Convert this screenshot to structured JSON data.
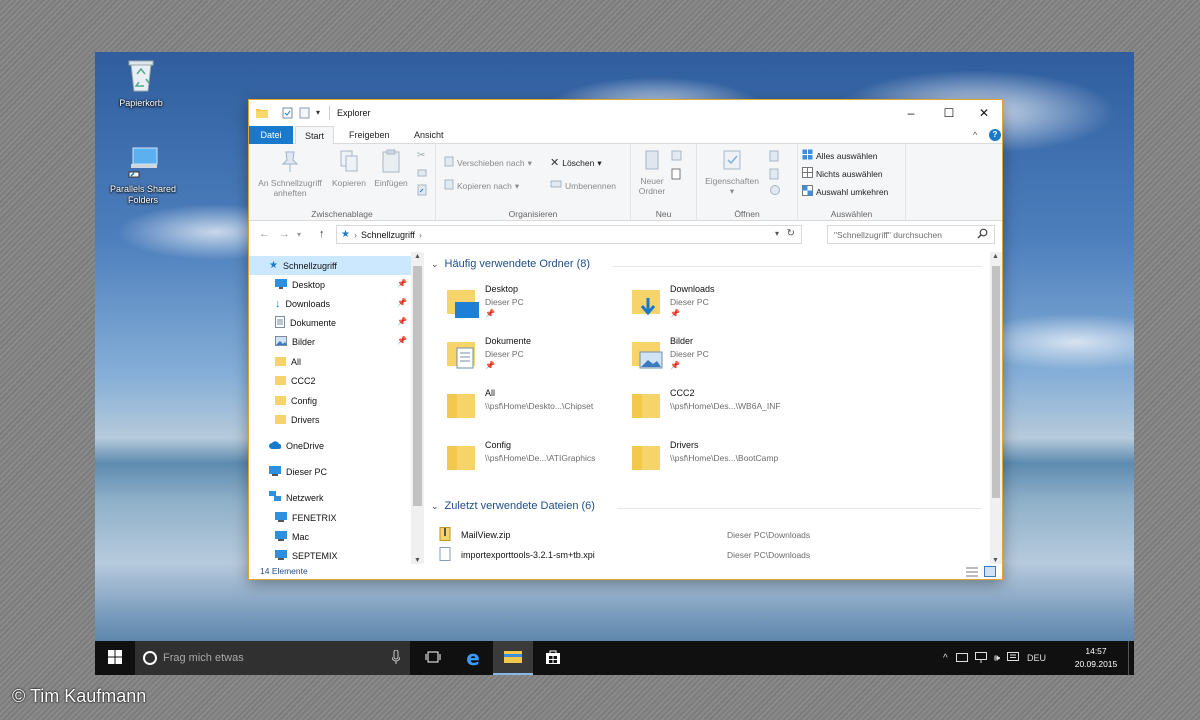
{
  "desktop": {
    "icons": [
      {
        "label": "Papierkorb",
        "icon": "recycle-bin-icon"
      },
      {
        "label": "Parallels Shared Folders",
        "icon": "shared-folder-icon"
      }
    ]
  },
  "window": {
    "title": "Explorer",
    "controls": {
      "minimize": "–",
      "maximize": "☐",
      "close": "✕"
    },
    "accent_color": "#1979ca",
    "tabs": [
      "Datei",
      "Start",
      "Freigeben",
      "Ansicht"
    ],
    "ribbon": {
      "help": "?",
      "collapse": "^",
      "groups": {
        "zwischenablage": {
          "label": "Zwischenablage",
          "pin_label": "An Schnellzugriff anheften",
          "copy_label": "Kopieren",
          "paste_label": "Einfügen"
        },
        "organisieren": {
          "label": "Organisieren",
          "move_label": "Verschieben nach",
          "copy_to_label": "Kopieren nach",
          "delete_label": "Löschen",
          "rename_label": "Umbenennen"
        },
        "neu": {
          "label": "Neu",
          "new_folder_label": "Neuer Ordner"
        },
        "oeffnen": {
          "label": "Öffnen",
          "properties_label": "Eigenschaften"
        },
        "auswaehlen": {
          "label": "Auswählen",
          "select_all": "Alles auswählen",
          "select_none": "Nichts auswählen",
          "invert": "Auswahl umkehren"
        }
      }
    },
    "address": {
      "crumb": "Schnellzugriff",
      "separator": "›",
      "search_placeholder": "\"Schnellzugriff\" durchsuchen"
    },
    "nav": [
      {
        "label": "Schnellzugriff",
        "icon": "star-icon",
        "selected": true
      },
      {
        "label": "Desktop",
        "icon": "desktop-icon",
        "pinned": true
      },
      {
        "label": "Downloads",
        "icon": "download-icon",
        "pinned": true
      },
      {
        "label": "Dokumente",
        "icon": "document-icon",
        "pinned": true
      },
      {
        "label": "Bilder",
        "icon": "picture-icon",
        "pinned": true
      },
      {
        "label": "All",
        "icon": "folder-icon"
      },
      {
        "label": "CCC2",
        "icon": "folder-icon"
      },
      {
        "label": "Config",
        "icon": "folder-icon"
      },
      {
        "label": "Drivers",
        "icon": "folder-icon"
      },
      {
        "label": "OneDrive",
        "icon": "cloud-icon"
      },
      {
        "label": "Dieser PC",
        "icon": "pc-icon"
      },
      {
        "label": "Netzwerk",
        "icon": "network-icon"
      },
      {
        "label": "FENETRIX",
        "icon": "computer-icon"
      },
      {
        "label": "Mac",
        "icon": "computer-icon"
      },
      {
        "label": "SEPTEMIX",
        "icon": "computer-icon"
      }
    ],
    "frequent": {
      "heading": "Häufig verwendete Ordner (8)",
      "items": [
        {
          "name": "Desktop",
          "sub": "Dieser PC",
          "pinned": true
        },
        {
          "name": "Downloads",
          "sub": "Dieser PC",
          "pinned": true
        },
        {
          "name": "Dokumente",
          "sub": "Dieser PC",
          "pinned": true
        },
        {
          "name": "Bilder",
          "sub": "Dieser PC",
          "pinned": true
        },
        {
          "name": "All",
          "sub": "\\\\psf\\Home\\Deskto...\\Chipset"
        },
        {
          "name": "CCC2",
          "sub": "\\\\psf\\Home\\Des...\\WB6A_INF"
        },
        {
          "name": "Config",
          "sub": "\\\\psf\\Home\\De...\\ATIGraphics"
        },
        {
          "name": "Drivers",
          "sub": "\\\\psf\\Home\\Des...\\BootCamp"
        }
      ]
    },
    "recent": {
      "heading": "Zuletzt verwendete Dateien (6)",
      "items": [
        {
          "name": "MailView.zip",
          "path": "Dieser PC\\Downloads"
        },
        {
          "name": "importexporttools-3.2.1-sm+tb.xpi",
          "path": "Dieser PC\\Downloads"
        }
      ]
    },
    "status": "14 Elemente"
  },
  "taskbar": {
    "search_placeholder": "Frag mich etwas",
    "language": "DEU",
    "time": "14:57",
    "date": "20.09.2015"
  },
  "credit": "© Tim Kaufmann"
}
